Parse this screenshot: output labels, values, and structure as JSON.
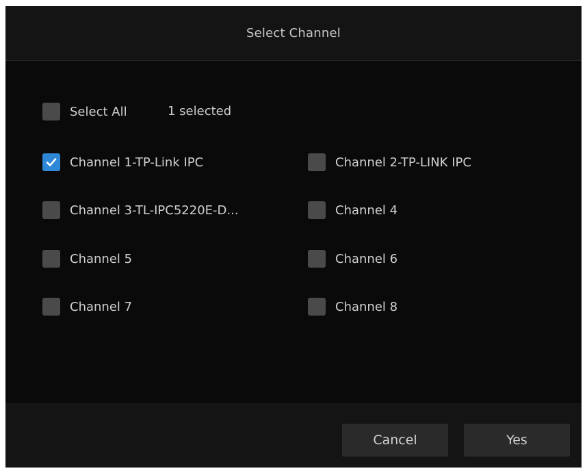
{
  "dialog": {
    "title": "Select Channel"
  },
  "select_all": {
    "label": "Select All",
    "checked": false,
    "selected_count_text": "1 selected"
  },
  "channels": [
    {
      "label": "Channel 1-TP-Link IPC",
      "checked": true
    },
    {
      "label": "Channel 2-TP-LINK IPC",
      "checked": false
    },
    {
      "label": "Channel 3-TL-IPC5220E-D...",
      "checked": false
    },
    {
      "label": "Channel 4",
      "checked": false
    },
    {
      "label": "Channel 5",
      "checked": false
    },
    {
      "label": "Channel 6",
      "checked": false
    },
    {
      "label": "Channel 7",
      "checked": false
    },
    {
      "label": "Channel 8",
      "checked": false
    }
  ],
  "buttons": {
    "cancel_label": "Cancel",
    "yes_label": "Yes"
  },
  "colors": {
    "dialog_background": "#0a0a0a",
    "checkbox_checked": "#2f87d8",
    "checkbox_unchecked": "#4a4a4a",
    "text": "#d0d0d0"
  }
}
